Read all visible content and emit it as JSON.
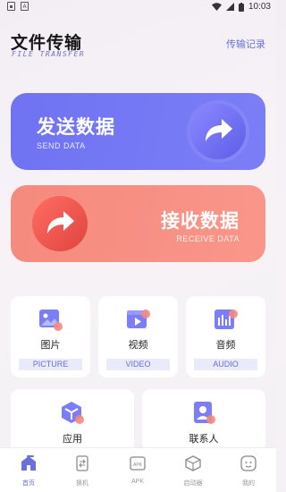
{
  "status_bar": {
    "time": "10:03",
    "left_icons": [
      "notification-icon",
      "a-icon"
    ],
    "right_icons": [
      "wifi-icon",
      "signal-icon",
      "battery-icon"
    ]
  },
  "header": {
    "title": "文件传输",
    "subtitle": "FILE TRANSFER",
    "history_link": "传输记录"
  },
  "send_card": {
    "title": "发送数据",
    "subtitle": "SEND DATA",
    "icon": "share-arrow-icon",
    "color": "#7377f4"
  },
  "receive_card": {
    "title": "接收数据",
    "subtitle": "RECEIVE DATA",
    "icon": "share-arrow-icon",
    "color": "#f7907f"
  },
  "categories": [
    {
      "label": "图片",
      "label_en": "PICTURE",
      "icon": "picture-icon"
    },
    {
      "label": "视频",
      "label_en": "VIDEO",
      "icon": "video-icon"
    },
    {
      "label": "音频",
      "label_en": "AUDIO",
      "icon": "audio-icon"
    },
    {
      "label": "应用",
      "icon": "app-icon"
    },
    {
      "label": "联系人",
      "icon": "contacts-icon"
    }
  ],
  "bottom_nav": [
    {
      "label": "首页",
      "icon": "home-icon",
      "active": true
    },
    {
      "label": "换机",
      "icon": "phone-switch-icon",
      "active": false
    },
    {
      "label": "APK",
      "icon": "apk-icon",
      "active": false
    },
    {
      "label": "启动器",
      "icon": "launcher-icon",
      "active": false
    },
    {
      "label": "我的",
      "icon": "profile-icon",
      "active": false
    }
  ],
  "colors": {
    "accent": "#6b6fd8",
    "coral": "#f58a7d"
  }
}
